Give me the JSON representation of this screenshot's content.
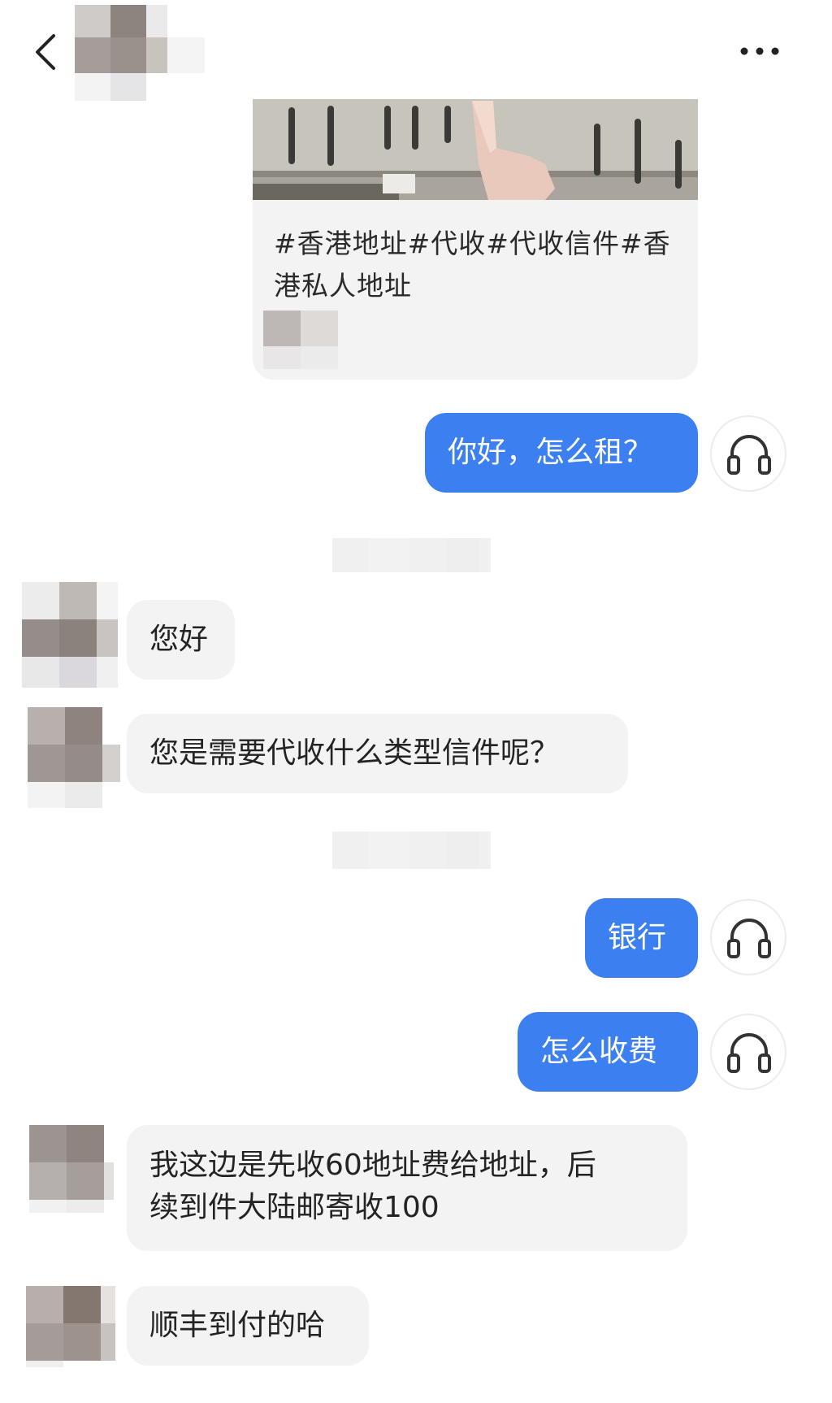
{
  "header": {
    "back_icon": "chevron-left-icon",
    "more_icon": "more-horizontal-icon"
  },
  "shared_card": {
    "title": "#香港地址#代收#代收信件#香港私人地址"
  },
  "messages": [
    {
      "side": "out",
      "text": "你好，怎么租？"
    },
    {
      "side": "in",
      "text": "您好"
    },
    {
      "side": "in",
      "text": "您是需要代收什么类型信件呢？"
    },
    {
      "side": "out",
      "text": "银行"
    },
    {
      "side": "out",
      "text": "怎么收费"
    },
    {
      "side": "in",
      "text_line1": "我这边是先收60地址费给地址，后",
      "text_line2": "续到件大陆邮寄收100"
    },
    {
      "side": "in",
      "text": "顺丰到付的哈"
    }
  ],
  "colors": {
    "outgoing_bubble": "#3b7ff0",
    "incoming_bubble": "#f3f3f3",
    "background": "#ffffff"
  },
  "icons": {
    "headset": "headset-icon",
    "avatar": "avatar-pixelated"
  }
}
